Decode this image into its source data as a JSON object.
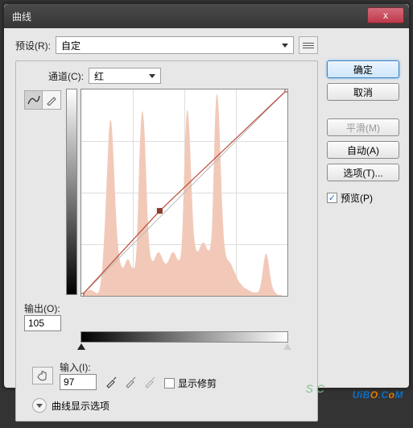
{
  "title": "曲线",
  "close_x": "x",
  "preset": {
    "label": "预设(R):",
    "value": "自定"
  },
  "channel": {
    "label": "通道(C):",
    "value": "红"
  },
  "output": {
    "label": "输出(O):",
    "value": "105"
  },
  "input": {
    "label": "输入(I):",
    "value": "97"
  },
  "show_clipping": {
    "label": "显示修剪"
  },
  "display_options": "曲线显示选项",
  "buttons": {
    "ok": "确定",
    "cancel": "取消",
    "smooth": "平滑(M)",
    "auto": "自动(A)",
    "options": "选项(T)..."
  },
  "preview": {
    "label": "预览(P)"
  },
  "watermark": {
    "text_pre": "UiB",
    "text_o": "O",
    "text_post": ".C",
    "text_o2": "o",
    "text_end": "M"
  },
  "sc_mark": "S C",
  "chart_data": {
    "type": "line",
    "title": "",
    "xlabel": "输入",
    "ylabel": "输出",
    "xlim": [
      0,
      255
    ],
    "ylim": [
      0,
      255
    ],
    "curve_points": [
      {
        "x": 0,
        "y": 0
      },
      {
        "x": 97,
        "y": 105
      },
      {
        "x": 255,
        "y": 255
      }
    ],
    "histogram_color": "#f2c9b8",
    "histogram": [
      2,
      2,
      3,
      3,
      4,
      4,
      5,
      5,
      6,
      6,
      7,
      7,
      8,
      8,
      7,
      7,
      6,
      6,
      5,
      5,
      4,
      4,
      3,
      3,
      4,
      5,
      8,
      12,
      18,
      25,
      35,
      48,
      62,
      78,
      95,
      115,
      135,
      155,
      175,
      195,
      208,
      215,
      218,
      215,
      205,
      190,
      172,
      152,
      132,
      112,
      95,
      80,
      68,
      58,
      50,
      44,
      40,
      38,
      36,
      35,
      35,
      36,
      38,
      40,
      42,
      44,
      45,
      45,
      44,
      42,
      40,
      38,
      36,
      35,
      34,
      34,
      35,
      38,
      45,
      58,
      78,
      105,
      135,
      165,
      190,
      210,
      222,
      228,
      228,
      222,
      210,
      192,
      170,
      145,
      120,
      98,
      80,
      66,
      56,
      50,
      46,
      44,
      43,
      43,
      44,
      46,
      48,
      50,
      52,
      53,
      54,
      54,
      53,
      52,
      50,
      48,
      46,
      44,
      42,
      41,
      40,
      40,
      40,
      41,
      42,
      44,
      46,
      48,
      50,
      52,
      53,
      54,
      54,
      53,
      52,
      50,
      48,
      46,
      45,
      44,
      44,
      45,
      48,
      55,
      68,
      88,
      115,
      145,
      175,
      200,
      218,
      228,
      230,
      225,
      214,
      198,
      178,
      155,
      132,
      110,
      92,
      78,
      68,
      62,
      58,
      56,
      55,
      55,
      56,
      58,
      60,
      62,
      64,
      65,
      66,
      66,
      65,
      64,
      62,
      60,
      58,
      57,
      56,
      56,
      58,
      62,
      70,
      85,
      108,
      138,
      172,
      205,
      230,
      245,
      250,
      248,
      238,
      222,
      200,
      176,
      150,
      126,
      104,
      86,
      72,
      62,
      55,
      50,
      47,
      45,
      44,
      43,
      42,
      41,
      40,
      38,
      36,
      34,
      32,
      30,
      28,
      26,
      24,
      22,
      20,
      18,
      17,
      16,
      15,
      14,
      13,
      12,
      11,
      10,
      10,
      9,
      9,
      8,
      8,
      7,
      7,
      6,
      6,
      5,
      5,
      5,
      4,
      4,
      4,
      4,
      4,
      4,
      4,
      5,
      6,
      8,
      11,
      15,
      20,
      26,
      33,
      40,
      46,
      50,
      52,
      52,
      50,
      46,
      40,
      34,
      28,
      22,
      17,
      13,
      10,
      8,
      6,
      5,
      4,
      3,
      2,
      2,
      1,
      1,
      1,
      1,
      1,
      0,
      0,
      0,
      0,
      0,
      0,
      0,
      0,
      0
    ]
  }
}
